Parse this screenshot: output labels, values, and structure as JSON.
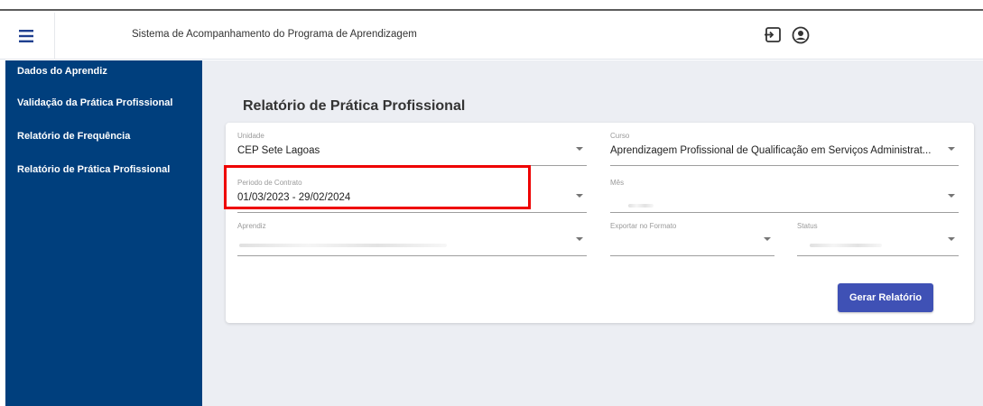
{
  "header": {
    "title": "Sistema de Acompanhamento do Programa de Aprendizagem",
    "menu_icon": "hamburger-menu-icon",
    "logout_icon": "logout-icon",
    "user_icon": "account-circle-icon"
  },
  "sidebar": {
    "items": [
      {
        "label": "Dados do Aprendiz"
      },
      {
        "label": "Validação da Prática Profissional"
      },
      {
        "label": "Relatório de Frequência"
      },
      {
        "label": "Relatório de Prática Profissional"
      }
    ]
  },
  "main": {
    "title": "Relatório de Prática Profissional"
  },
  "form": {
    "unidade": {
      "label": "Unidade",
      "value": "CEP Sete Lagoas"
    },
    "curso": {
      "label": "Curso",
      "value": "Aprendizagem Profissional de Qualificação em Serviços Administrat..."
    },
    "periodo": {
      "label": "Periodo de Contrato",
      "value": "01/03/2023 - 29/02/2024"
    },
    "mes": {
      "label": "Mês",
      "value": ""
    },
    "aprendiz": {
      "label": "Aprendiz",
      "value": ""
    },
    "exportar": {
      "label": "Exportar no Formato",
      "value": ""
    },
    "status": {
      "label": "Status",
      "value": ""
    },
    "submit_label": "Gerar Relatório"
  },
  "colors": {
    "sidebar_bg": "#003f7d",
    "button_bg": "#3f51b5",
    "highlight": "#ee0000",
    "main_bg": "#eceef3"
  }
}
